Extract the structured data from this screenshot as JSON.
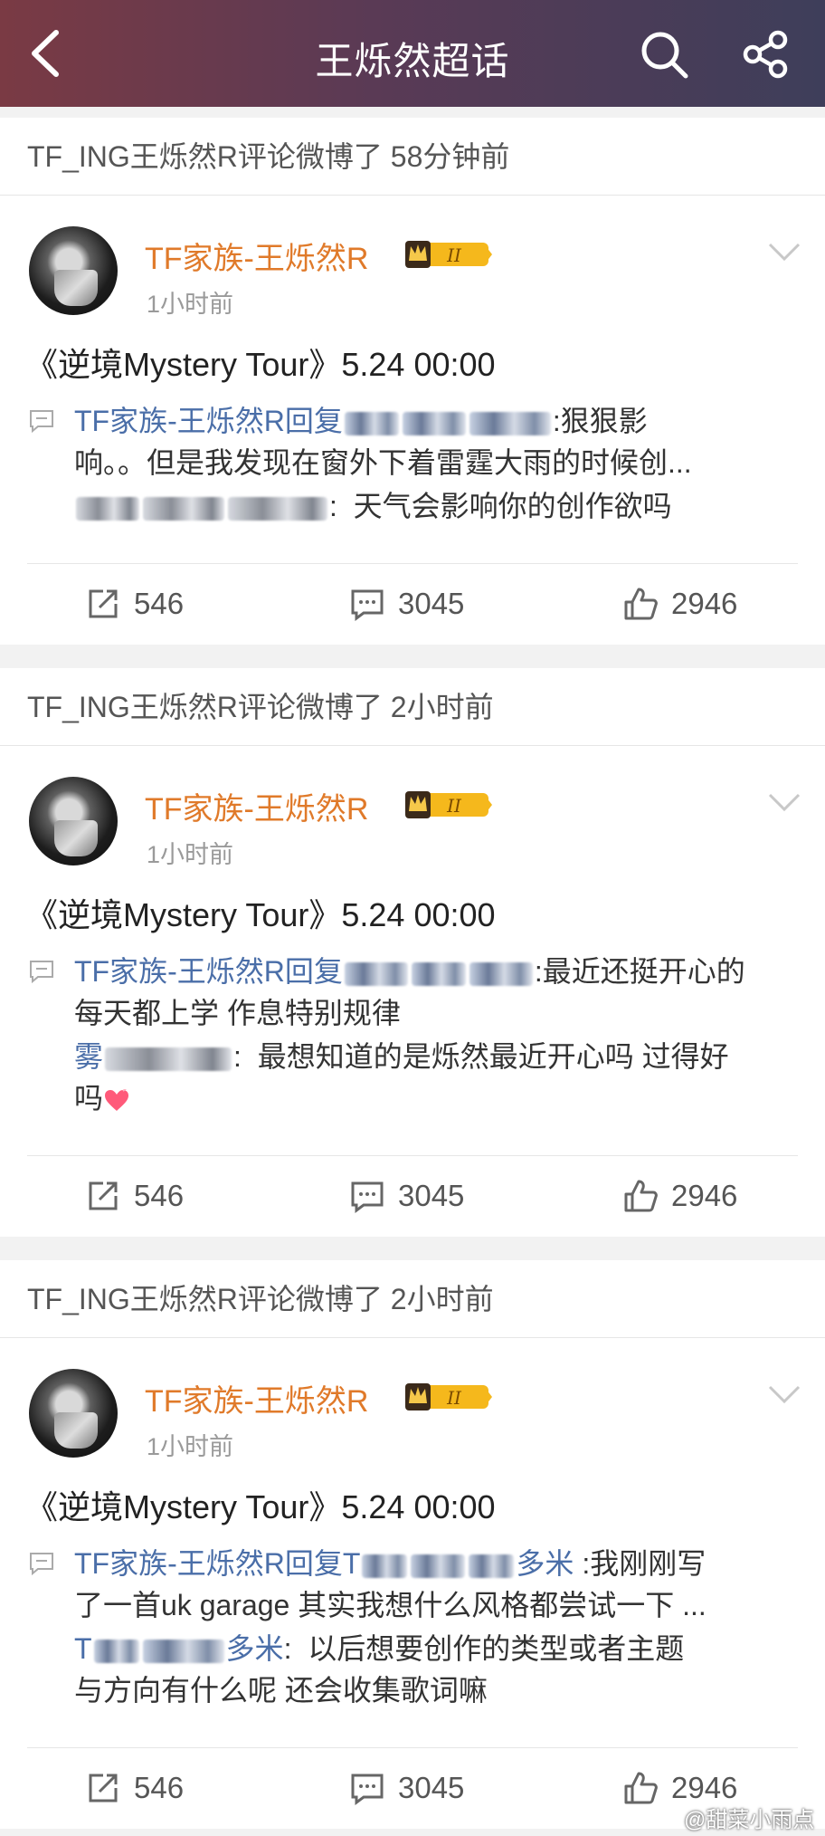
{
  "header": {
    "title": "王烁然超话"
  },
  "posts": [
    {
      "head": "TF_ING王烁然R评论微博了 58分钟前",
      "user": "TF家族-王烁然R",
      "time": "1小时前",
      "text": "《逆境Mystery Tour》5.24 00:00",
      "reply_prefix": "TF家族-王烁然R回复",
      "reply_tail": ":狠狠影",
      "reply_line2": "响。。但是我发现在窗外下着雷霆大雨的时候创...",
      "orig_text": "天气会影响你的创作欲吗",
      "reposts": "546",
      "comments": "3045",
      "likes": "2946"
    },
    {
      "head": "TF_ING王烁然R评论微博了 2小时前",
      "user": "TF家族-王烁然R",
      "time": "1小时前",
      "text": "《逆境Mystery Tour》5.24 00:00",
      "reply_prefix": "TF家族-王烁然R回复",
      "reply_tail": ":最近还挺开心的",
      "reply_line2": "每天都上学 作息特别规律",
      "orig_user_visible": "雾",
      "orig_text": "最想知道的是烁然最近开心吗 过得好",
      "orig_line2": "吗",
      "reposts": "546",
      "comments": "3045",
      "likes": "2946"
    },
    {
      "head": "TF_ING王烁然R评论微博了 2小时前",
      "user": "TF家族-王烁然R",
      "time": "1小时前",
      "text": "《逆境Mystery Tour》5.24 00:00",
      "reply_prefix": "TF家族-王烁然R回复",
      "reply_user_start": "T",
      "reply_user_end": "多米",
      "reply_tail": ":我刚刚写",
      "reply_line2": "了一首uk garage 其实我想什么风格都尝试一下 ...",
      "orig_user_start": "T",
      "orig_user_end": "多米",
      "orig_text": "以后想要创作的类型或者主题",
      "orig_line2": "与方向有什么呢 还会收集歌词嘛",
      "reposts": "546",
      "comments": "3045",
      "likes": "2946"
    }
  ],
  "watermark": "@甜菜小雨点",
  "colors": {
    "accent_name": "#e07a2a",
    "link_blue": "#4a6ea8",
    "header_gradient_start": "#7a3a44",
    "header_gradient_end": "#3e3e5a"
  },
  "icons": [
    "back-arrow-icon",
    "search-icon",
    "share-icon",
    "chevron-down-icon",
    "comment-bubble-icon",
    "repost-icon",
    "comment-icon",
    "like-icon",
    "level-badge-icon",
    "heart-emoji-icon"
  ]
}
